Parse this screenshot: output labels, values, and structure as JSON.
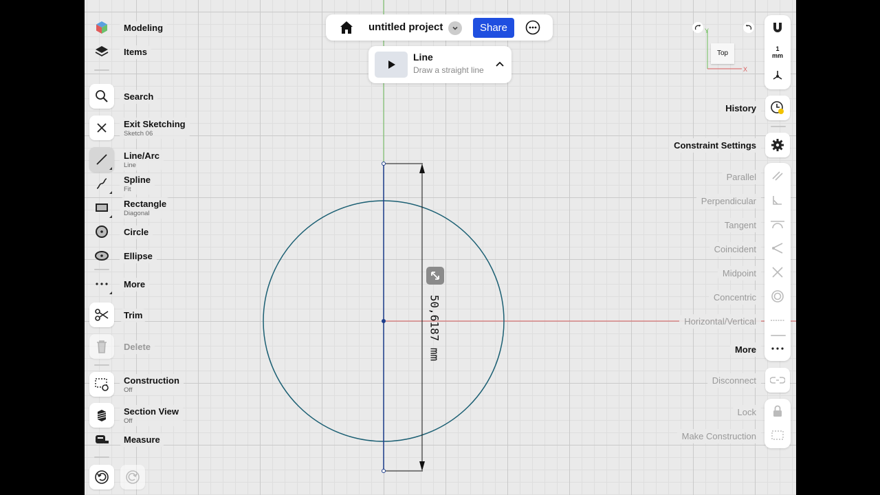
{
  "colors": {
    "accent": "#1f4fe0",
    "circle": "#1b5f73",
    "y_axis": "#6fbf5c",
    "x_axis": "#d95c5c",
    "sketch_line": "#1d3e8c"
  },
  "topbar": {
    "project_name": "untitled project",
    "share_label": "Share",
    "icons": [
      "home-icon",
      "chevron-down-icon",
      "more-icon"
    ]
  },
  "tool_tip": {
    "title": "Line",
    "subtitle": "Draw a straight line"
  },
  "left_toolbar": {
    "modeling": {
      "label": "Modeling"
    },
    "items": {
      "label": "Items"
    },
    "search": {
      "label": "Search"
    },
    "exit_sketching": {
      "label": "Exit Sketching",
      "sub": "Sketch 06"
    },
    "line_arc": {
      "label": "Line/Arc",
      "sub": "Line"
    },
    "spline": {
      "label": "Spline",
      "sub": "Fit"
    },
    "rectangle": {
      "label": "Rectangle",
      "sub": "Diagonal"
    },
    "circle": {
      "label": "Circle"
    },
    "ellipse": {
      "label": "Ellipse"
    },
    "more": {
      "label": "More"
    },
    "trim": {
      "label": "Trim"
    },
    "delete": {
      "label": "Delete"
    },
    "construction": {
      "label": "Construction",
      "sub": "Off"
    },
    "section_view": {
      "label": "Section View",
      "sub": "Off"
    },
    "measure": {
      "label": "Measure"
    }
  },
  "right_toolbar": {
    "units": "1\nmm",
    "view_cube_label": "Top",
    "axis_labels": {
      "y": "Y",
      "x": "X"
    },
    "history": "History",
    "constraint_settings": "Constraint Settings",
    "constraints": {
      "parallel": "Parallel",
      "perpendicular": "Perpendicular",
      "tangent": "Tangent",
      "coincident": "Coincident",
      "midpoint": "Midpoint",
      "concentric": "Concentric",
      "horizontal_vertical": "Horizontal/Vertical",
      "more": "More"
    },
    "actions": {
      "disconnect": "Disconnect",
      "lock": "Lock",
      "make_construction": "Make Construction"
    }
  },
  "sketch": {
    "dimension_text": "50,6187 mm"
  }
}
